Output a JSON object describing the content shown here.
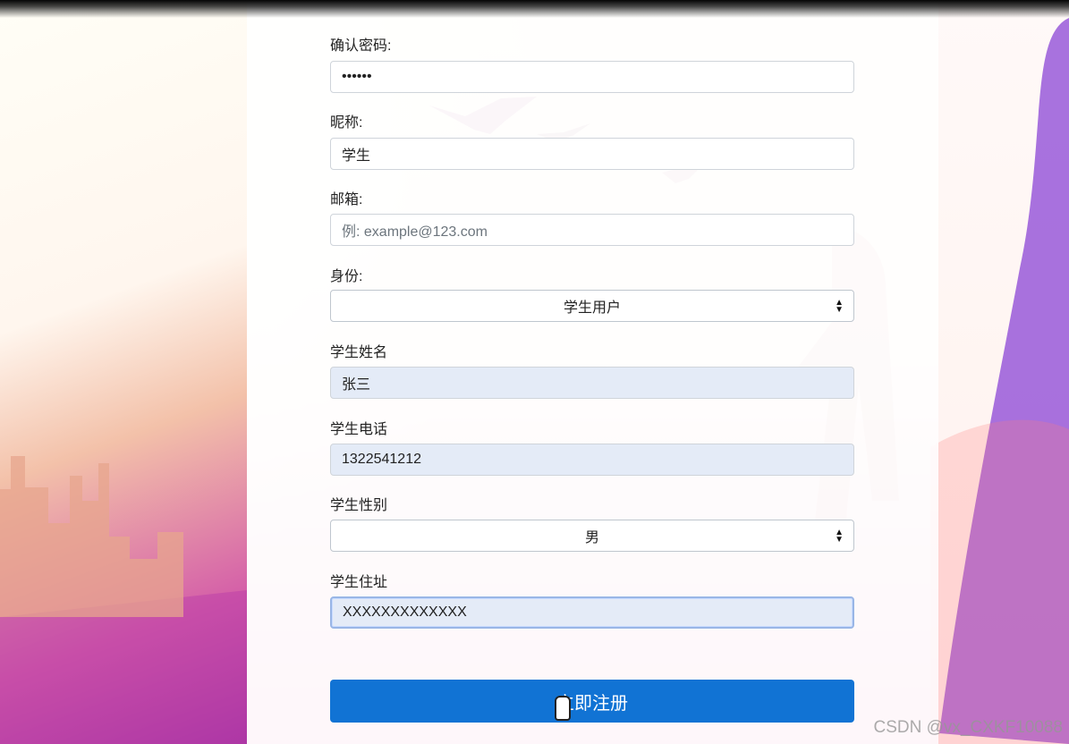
{
  "form": {
    "confirm_password_label": "确认密码:",
    "confirm_password_value": "••••••",
    "nickname_label": "昵称:",
    "nickname_value": "学生",
    "email_label": "邮箱:",
    "email_placeholder": "例: example@123.com",
    "role_label": "身份:",
    "role_selected": "学生用户",
    "student_name_label": "学生姓名",
    "student_name_value": "张三",
    "student_phone_label": "学生电话",
    "student_phone_value": "1322541212",
    "student_gender_label": "学生性别",
    "student_gender_selected": "男",
    "student_address_label": "学生住址",
    "student_address_value": "XXXXXXXXXXXXX",
    "submit_label": "立即注册"
  },
  "watermark": "CSDN @vx_CXKF10088",
  "icons": {
    "select_arrow": "updown-chevron-icon",
    "cursor": "hand-cursor-icon"
  },
  "colors": {
    "primary_button": "#1173d4",
    "filled_input_bg": "#e4ebf7",
    "page_bg": "#f7e6ef"
  }
}
